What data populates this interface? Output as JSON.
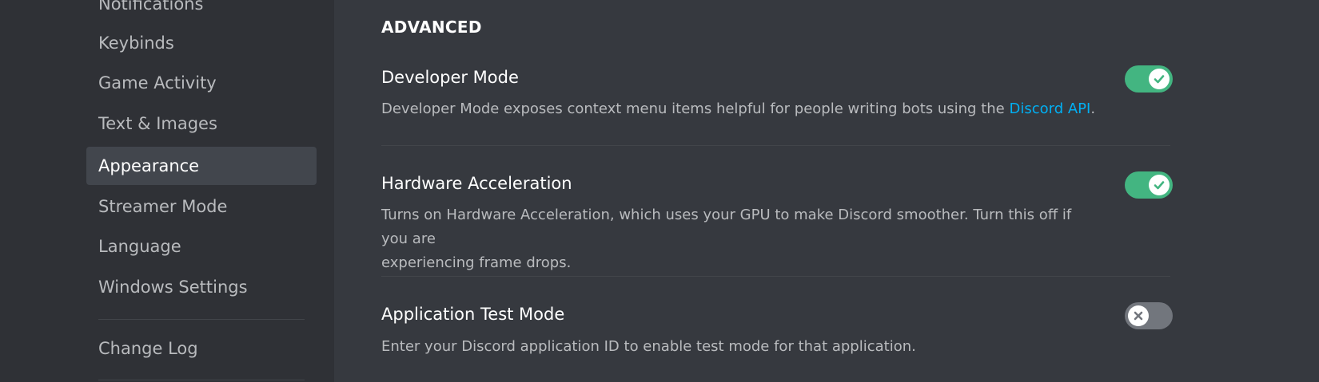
{
  "sidebar": {
    "items": [
      {
        "label": "Notifications",
        "selected": false
      },
      {
        "label": "Keybinds",
        "selected": false
      },
      {
        "label": "Game Activity",
        "selected": false
      },
      {
        "label": "Text & Images",
        "selected": false
      },
      {
        "label": "Appearance",
        "selected": true
      },
      {
        "label": "Streamer Mode",
        "selected": false
      },
      {
        "label": "Language",
        "selected": false
      },
      {
        "label": "Windows Settings",
        "selected": false
      }
    ],
    "footer_items": [
      {
        "label": "Change Log"
      }
    ]
  },
  "main": {
    "section_title": "ADVANCED",
    "settings": [
      {
        "title": "Developer Mode",
        "desc_before_link": "Developer Mode exposes context menu items helpful for people writing bots using the ",
        "link_text": "Discord API",
        "desc_after_link": ".",
        "enabled": true,
        "toggle_icon": "check-icon"
      },
      {
        "title": "Hardware Acceleration",
        "desc_line1": "Turns on Hardware Acceleration, which uses your GPU to make Discord smoother. Turn this off if you are",
        "desc_line2": "experiencing frame drops.",
        "enabled": true,
        "toggle_icon": "check-icon"
      },
      {
        "title": "Application Test Mode",
        "desc": "Enter your Discord application ID to enable test mode for that application.",
        "enabled": false,
        "toggle_icon": "close-icon"
      }
    ]
  },
  "colors": {
    "sidebar_bg": "#2f3136",
    "main_bg": "#36393f",
    "toggle_on": "#43b581",
    "toggle_off": "#72767d",
    "link": "#00b0f4"
  }
}
